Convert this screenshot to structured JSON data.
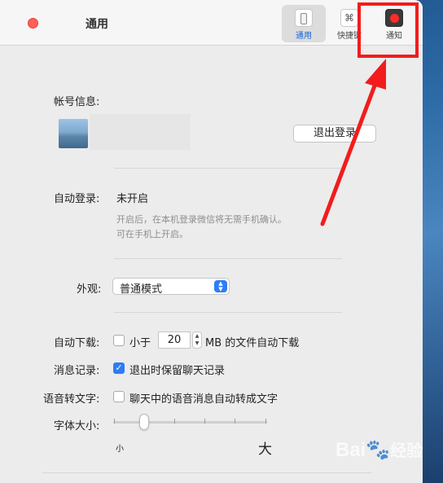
{
  "window": {
    "title": "通用"
  },
  "toolbar": {
    "tabs": [
      {
        "label": "通用",
        "icon": "switch-icon",
        "active": true
      },
      {
        "label": "快捷键",
        "icon": "command-icon",
        "glyph": "⌘"
      },
      {
        "label": "通知",
        "icon": "record-icon"
      }
    ]
  },
  "account": {
    "label": "帐号信息:",
    "logout_button": "退出登录"
  },
  "auto_login": {
    "label": "自动登录:",
    "value": "未开启",
    "hint_line1": "开启后，在本机登录微信将无需手机确认。",
    "hint_line2": "可在手机上开启。"
  },
  "appearance": {
    "label": "外观:",
    "selected": "普通模式"
  },
  "auto_download": {
    "label": "自动下载:",
    "checked": false,
    "prefix": "小于",
    "value": "20",
    "suffix": "MB 的文件自动下载"
  },
  "messages": {
    "label": "消息记录:",
    "checked": true,
    "text": "退出时保留聊天记录"
  },
  "voice_to_text": {
    "label": "语音转文字:",
    "checked": false,
    "text": "聊天中的语音消息自动转成文字"
  },
  "font_size": {
    "label": "字体大小:",
    "min_label": "小",
    "max_label": "大",
    "level_fraction": 0.2
  },
  "watermark": {
    "brand": "Bai",
    "suffix": "经验"
  },
  "colors": {
    "accent": "#2f7cf6",
    "annotation": "#f21c1c",
    "close": "#fe5f57"
  }
}
